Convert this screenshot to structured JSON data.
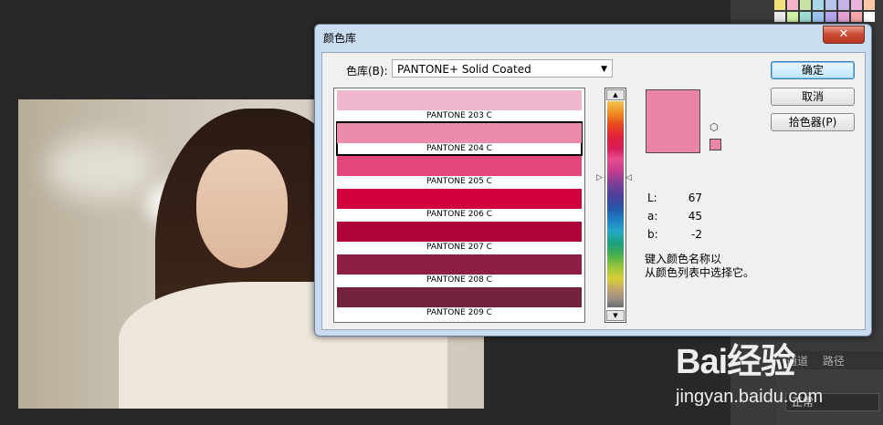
{
  "dialog": {
    "title": "颜色库",
    "close_label": "✕",
    "library_label": "色库(B):",
    "library_value": "PANTONE+ Solid Coated",
    "buttons": {
      "ok": "确定",
      "cancel": "取消",
      "picker": "拾色器(P)"
    },
    "swatches": [
      {
        "name": "PANTONE 203 C",
        "color": "#efb6cd"
      },
      {
        "name": "PANTONE 204 C",
        "color": "#ea8aac"
      },
      {
        "name": "PANTONE 205 C",
        "color": "#e2467b"
      },
      {
        "name": "PANTONE 206 C",
        "color": "#d1003d"
      },
      {
        "name": "PANTONE 207 C",
        "color": "#ad0338"
      },
      {
        "name": "PANTONE 208 C",
        "color": "#8f1e43"
      },
      {
        "name": "PANTONE 209 C",
        "color": "#74213d"
      }
    ],
    "selected_index": 1,
    "preview_color": "#ea84a8",
    "lab": [
      {
        "label": "L:",
        "value": "67"
      },
      {
        "label": "a:",
        "value": "45"
      },
      {
        "label": "b:",
        "value": "-2"
      }
    ],
    "hint_line1": "键入颜色名称以",
    "hint_line2": "从颜色列表中选择它。"
  },
  "background": {
    "layers_tabs": [
      "通道",
      "路径"
    ],
    "blend_mode": "正常"
  },
  "watermark": {
    "logo": "Bai经验",
    "url": "jingyan.baidu.com"
  }
}
